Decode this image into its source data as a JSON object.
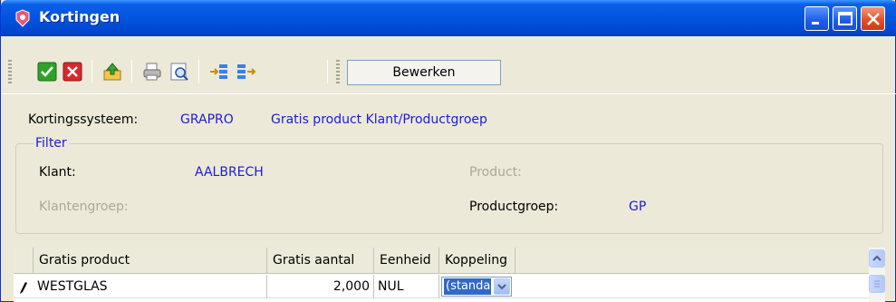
{
  "window": {
    "title": "Kortingen",
    "colors": {
      "titlebar": "#0254e0",
      "close": "#e3512a",
      "value_text": "#1c1cd8",
      "disabled_text": "#aca899",
      "selection": "#316ac5"
    }
  },
  "titlebar_buttons": [
    "minimize-icon",
    "maximize-icon",
    "close-icon"
  ],
  "toolbar": {
    "icons": [
      "confirm-check-icon",
      "cancel-x-icon",
      "export-icon",
      "print-icon",
      "preview-icon",
      "move-right-icon",
      "move-all-right-icon"
    ],
    "edit_label": "Bewerken"
  },
  "info": {
    "system_label": "Kortingssysteem:",
    "system_code": "GRAPRO",
    "system_desc": "Gratis product  Klant/Productgroep",
    "filter_legend": "Filter",
    "klant_label": "Klant:",
    "klant_value": "AALBRECH",
    "product_label": "Product:",
    "klantengroep_label": "Klantengroep:",
    "productgroep_label": "Productgroep:",
    "productgroep_value": "GP"
  },
  "grid": {
    "columns": [
      "Gratis product",
      "Gratis aantal",
      "Eenheid",
      "Koppeling"
    ],
    "rows": [
      {
        "product": "WESTGLAS",
        "aantal": "2,000",
        "eenheid": "NUL",
        "koppeling": "(standaa"
      }
    ]
  }
}
